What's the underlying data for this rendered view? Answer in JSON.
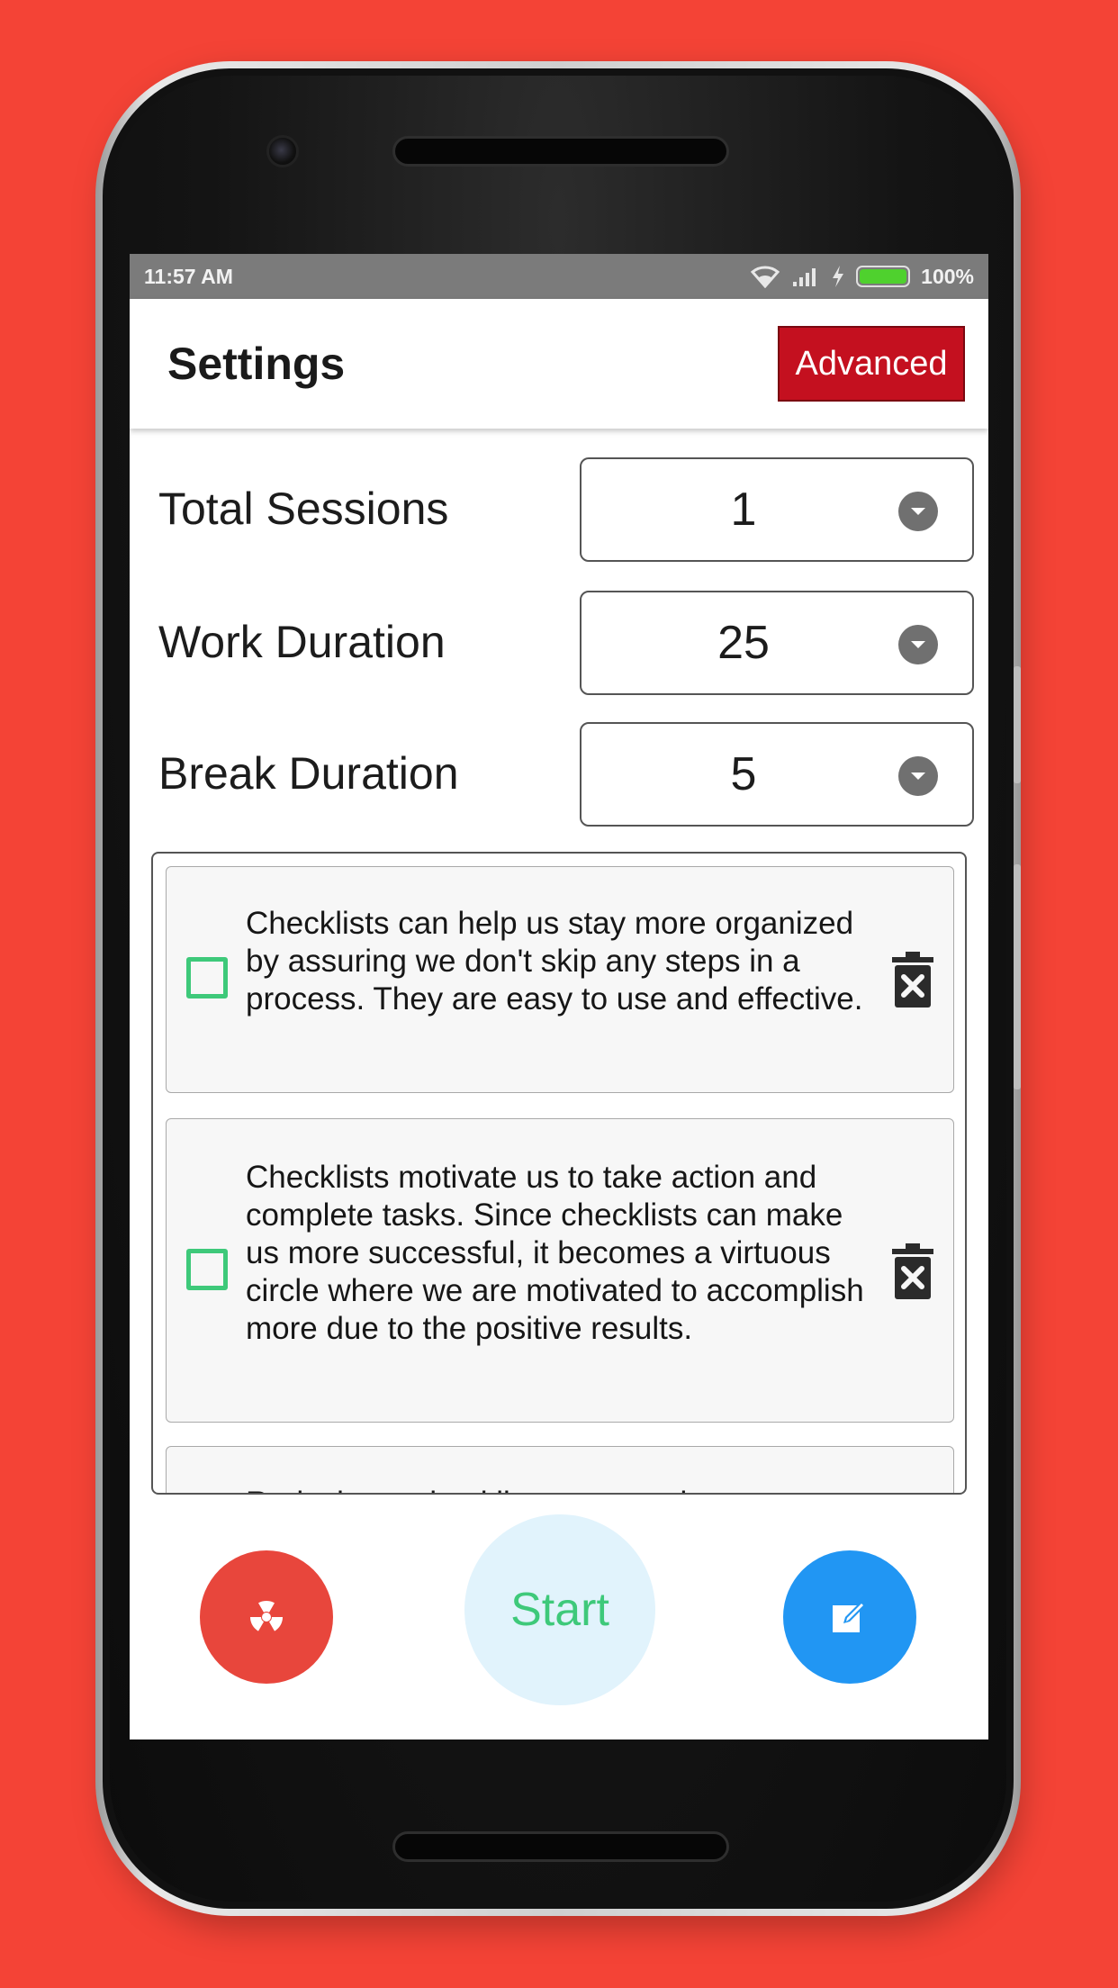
{
  "status_bar": {
    "time": "11:57 AM",
    "battery": "100%",
    "icons": [
      "wifi-icon",
      "signal-icon",
      "charging-icon",
      "battery-icon"
    ]
  },
  "app_bar": {
    "title": "Settings",
    "advanced_label": "Advanced"
  },
  "settings": [
    {
      "label": "Total Sessions",
      "value": "1"
    },
    {
      "label": "Work Duration",
      "value": "25"
    },
    {
      "label": "Break Duration",
      "value": "5"
    }
  ],
  "checklist": [
    {
      "text": "Checklists can help us stay more organized by assuring we don't skip any steps in a process. They are easy to use and effective.",
      "checked": false
    },
    {
      "text": "Checklists motivate us to take action and complete tasks. Since checklists can make us more successful, it becomes a virtuous circle where we are motivated to accomplish more due to the positive results.",
      "checked": false
    },
    {
      "text": "Reducing a checklist can complete",
      "checked": false
    }
  ],
  "actions": {
    "start_label": "Start",
    "left_icon": "radiation-icon",
    "right_icon": "edit-icon"
  },
  "colors": {
    "background": "#f44336",
    "advanced_button": "#c4101f",
    "checkbox": "#3ec97a",
    "start_text": "#3ec97a",
    "start_bg": "#e1f3fc",
    "fab_red": "#e8463c",
    "fab_blue": "#2196f3"
  }
}
